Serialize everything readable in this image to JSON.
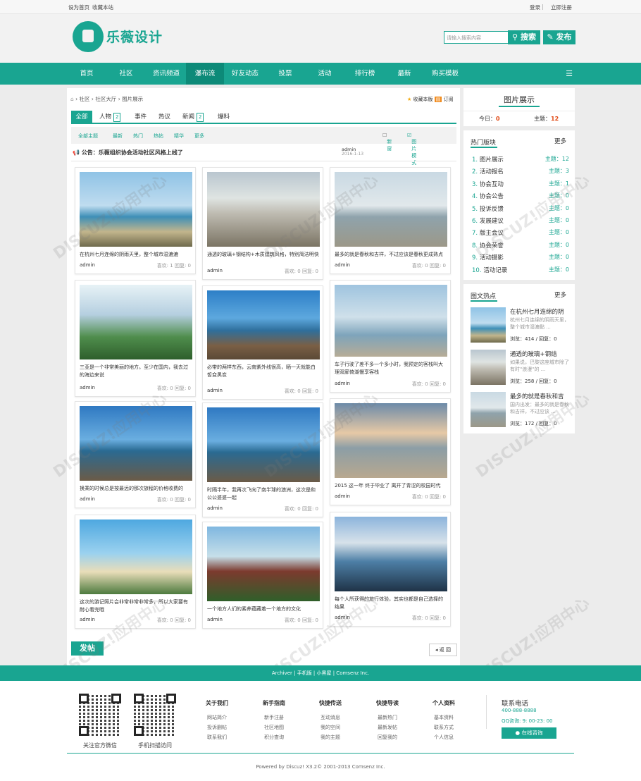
{
  "topbar": {
    "left": [
      "设为首页",
      "收藏本站"
    ],
    "right": [
      "登录",
      "立即注册"
    ]
  },
  "header": {
    "logo_text": "乐薇设计",
    "search_placeholder": "请输入搜索内容",
    "search_button": "搜索",
    "post_button": "发布"
  },
  "nav": {
    "items": [
      "首页",
      "社区",
      "资讯频道",
      "瀑布流",
      "好友动态",
      "投票",
      "活动",
      "排行榜",
      "最新",
      "购买模板"
    ],
    "active": "瀑布流"
  },
  "breadcrumb": {
    "items": [
      "社区",
      "社区大厅",
      "图片展示"
    ],
    "bookmark": "收藏本版",
    "subscribe": "订阅"
  },
  "tabs": [
    {
      "label": "全部"
    },
    {
      "label": "人物",
      "count": "2"
    },
    {
      "label": "事件"
    },
    {
      "label": "热议"
    },
    {
      "label": "新闻",
      "count": "2"
    },
    {
      "label": "爆料"
    }
  ],
  "filter": {
    "items": [
      "全部主题",
      "最新",
      "热门",
      "热帖",
      "精华",
      "更多"
    ],
    "new_window": "新窗",
    "pic_mode": "图片模式"
  },
  "notice": {
    "text": "公告：乐薇组织协会活动社区风格上线了",
    "author": "admin",
    "date": "2016-1-13"
  },
  "cards": [
    {
      "caption": "在杭州七月连绵的阴雨天里，整个城市湿漉漉",
      "author": "admin",
      "likes": "喜欢: 1",
      "replies": "回复: 0"
    },
    {
      "caption": "通透的玻璃+钢结构+木质建筑风格，特别简洁明快",
      "author": "admin",
      "likes": "喜欢: 0",
      "replies": "回复: 0"
    },
    {
      "caption": "最多的就是春秋和吉祥，不过应该是春秋更成熟点",
      "author": "admin",
      "likes": "喜欢: 0",
      "replies": "回复: 0"
    },
    {
      "caption": "三亚是一个非常美丽的地方。至少在国内，我去过的海边来说",
      "author": "admin",
      "likes": "喜欢: 0",
      "replies": "回复: 0"
    },
    {
      "caption": "必带的两样东西，云南紫外线很高，晒一天就能白皙变黑炭",
      "author": "admin",
      "likes": "喜欢: 0",
      "replies": "回复: 0"
    },
    {
      "caption": "车子行驶了差不多一个多小时，我预定的客栈叫大理双廊倚湖慢享客栈",
      "author": "admin",
      "likes": "喜欢: 0",
      "replies": "回复: 0"
    },
    {
      "caption": "换乘的时候总是按最远的那次旅程的价格收费的",
      "author": "admin",
      "likes": "喜欢: 0",
      "replies": "回复: 0"
    },
    {
      "caption": "时隔半年，我再次飞向了南半球的澳洲，这次是和公公婆婆一起",
      "author": "admin",
      "likes": "喜欢: 0",
      "replies": "回复: 0"
    },
    {
      "caption": "2015 这一年 终于毕业了 离开了青涩的校园时代",
      "author": "admin",
      "likes": "喜欢: 0",
      "replies": "回复: 0"
    },
    {
      "caption": "这次的游记照片会非常非常非常多，所以大家要有耐心看完哦",
      "author": "admin",
      "likes": "喜欢: 0",
      "replies": "回复: 0"
    },
    {
      "caption": "一个地方人们的素养蕴藏着一个地方的文化",
      "author": "admin",
      "likes": "喜欢: 0",
      "replies": "回复: 0"
    },
    {
      "caption": "每个人所获得的旅行体验，其实也都是自己选择的结果",
      "author": "admin",
      "likes": "喜欢: 0",
      "replies": "回复: 0"
    }
  ],
  "post_button": "发帖",
  "back_button": "返 回",
  "sidebar": {
    "title": "图片展示",
    "today_label": "今日：",
    "today": "0",
    "topics_label": "主题：",
    "topics": "12",
    "hot_title": "热门版块",
    "more": "更多",
    "hot": [
      {
        "n": "1.",
        "name": "图片展示",
        "r": "主题：12"
      },
      {
        "n": "2.",
        "name": "活动报名",
        "r": "主题：3"
      },
      {
        "n": "3.",
        "name": "协会互动",
        "r": "主题：1"
      },
      {
        "n": "4.",
        "name": "协会公告",
        "r": "主题：0"
      },
      {
        "n": "5.",
        "name": "投诉反馈",
        "r": "主题：0"
      },
      {
        "n": "6.",
        "name": "发展建议",
        "r": "主题：0"
      },
      {
        "n": "7.",
        "name": "版主会议",
        "r": "主题：0"
      },
      {
        "n": "8.",
        "name": "协会荣誉",
        "r": "主题：0"
      },
      {
        "n": "9.",
        "name": "活动摄影",
        "r": "主题：0"
      },
      {
        "n": "10.",
        "name": "活动记录",
        "r": "主题：0"
      }
    ],
    "pic_title": "图文热点",
    "pic_more": "更多",
    "pics": [
      {
        "title": "在杭州七月连绵的阴",
        "desc": "杭州七月连绵的阴雨天里，整个城市湿漉黏 ...",
        "views": "浏览：414 / 回复：0"
      },
      {
        "title": "通透的玻璃+钢结",
        "desc": "如果说，巴黎这座城市除了有时\"浪漫\"的 ...",
        "views": "浏览：258 / 回复：0"
      },
      {
        "title": "最多的就是春秋和吉",
        "desc": "国内出发：最多的就是春秋和吉祥，不过应该 ...",
        "views": "浏览：172 / 回复：0"
      }
    ]
  },
  "footer": {
    "links_bar": "Archiver | 手机版 | 小黑屋 | Comsenz Inc.",
    "qr1": "关注官方微信",
    "qr2": "手机扫描访问",
    "cols": [
      {
        "title": "关于我们",
        "items": [
          "网站简介",
          "投诉删帖",
          "联系我们"
        ]
      },
      {
        "title": "新手指南",
        "items": [
          "新手注册",
          "社区地图",
          "积分查询"
        ]
      },
      {
        "title": "快捷传送",
        "items": [
          "互动消息",
          "我的空间",
          "我的主题"
        ]
      },
      {
        "title": "快捷导读",
        "items": [
          "最新热门",
          "最新发帖",
          "回复我的"
        ]
      },
      {
        "title": "个人资料",
        "items": [
          "基本资料",
          "联系方式",
          "个人信息"
        ]
      }
    ],
    "phone_title": "联系电话",
    "phone": "400-888-8888",
    "qq": "QQ咨询: 9: 00-23: 00",
    "online": "在线咨询",
    "powered": "Powered by Discuz! X3.2© 2001-2013 Comsenz Inc."
  },
  "colors": {
    "accent": "#19a591",
    "accent_dark": "#0d8a78",
    "danger": "#e0440e"
  }
}
